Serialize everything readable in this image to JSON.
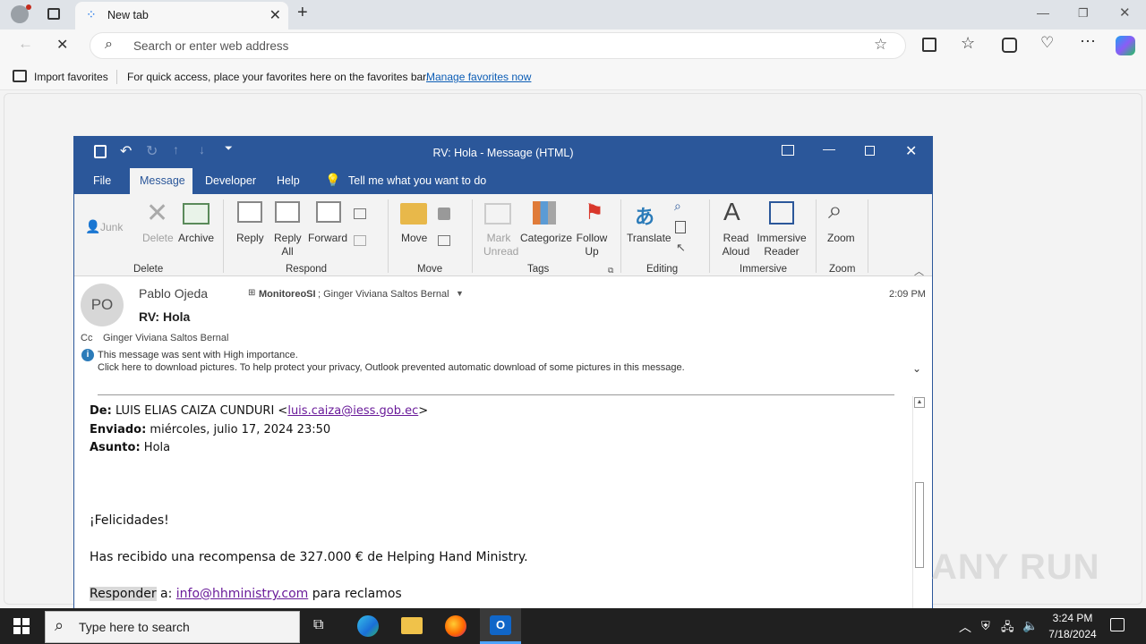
{
  "browser": {
    "tab_title": "New tab",
    "address_placeholder": "Search or enter web address",
    "import_favorites": "Import favorites",
    "fav_hint": "For quick access, place your favorites here on the favorites bar.",
    "manage_favorites": "Manage favorites now"
  },
  "outlook": {
    "window_title": "RV: Hola  -  Message (HTML)",
    "menu": {
      "file": "File",
      "message": "Message",
      "developer": "Developer",
      "help": "Help",
      "tell_me": "Tell me what you want to do"
    },
    "ribbon": {
      "junk": "Junk",
      "delete": "Delete",
      "archive": "Archive",
      "reply": "Reply",
      "reply_all_1": "Reply",
      "reply_all_2": "All",
      "forward": "Forward",
      "move": "Move",
      "mark_unread_1": "Mark",
      "mark_unread_2": "Unread",
      "categorize": "Categorize",
      "follow_up_1": "Follow",
      "follow_up_2": "Up",
      "translate": "Translate",
      "read_aloud_1": "Read",
      "read_aloud_2": "Aloud",
      "immersive_1": "Immersive",
      "immersive_2": "Reader",
      "zoom": "Zoom",
      "groups": {
        "delete": "Delete",
        "respond": "Respond",
        "move": "Move",
        "tags": "Tags",
        "editing": "Editing",
        "immersive": "Immersive",
        "zoom": "Zoom"
      }
    },
    "header": {
      "initials": "PO",
      "sender": "Pablo Ojeda",
      "subject": "RV: Hola",
      "to_bold": "MonitoreoSI",
      "to_rest": "; Ginger Viviana Saltos Bernal",
      "time": "2:09 PM",
      "cc_label": "Cc",
      "cc": "Ginger Viviana Saltos Bernal",
      "importance": "This message was sent with High importance.",
      "pictures": "Click here to download pictures. To help protect your privacy, Outlook prevented automatic download of some pictures in this message."
    },
    "body": {
      "from_label": "De:",
      "from_name": "LUIS ELIAS CAIZA CUNDURI <",
      "from_email": "luis.caiza@iess.gob.ec",
      "from_close": ">",
      "sent_label": "Enviado:",
      "sent_value": "miércoles, julio 17, 2024 23:50",
      "subject_label": "Asunto:",
      "subject_value": "Hola",
      "congrats": "¡Felicidades!",
      "reward": "Has recibido una recompensa de 327.000 € de Helping Hand Ministry.",
      "reply_label": "Responder",
      "reply_mid": " a: ",
      "reply_email": "info@hhministry.com",
      "reply_end": " para reclamos"
    }
  },
  "taskbar": {
    "search_placeholder": "Type here to search",
    "time": "3:24 PM",
    "date": "7/18/2024"
  },
  "watermark": "ANY RUN"
}
